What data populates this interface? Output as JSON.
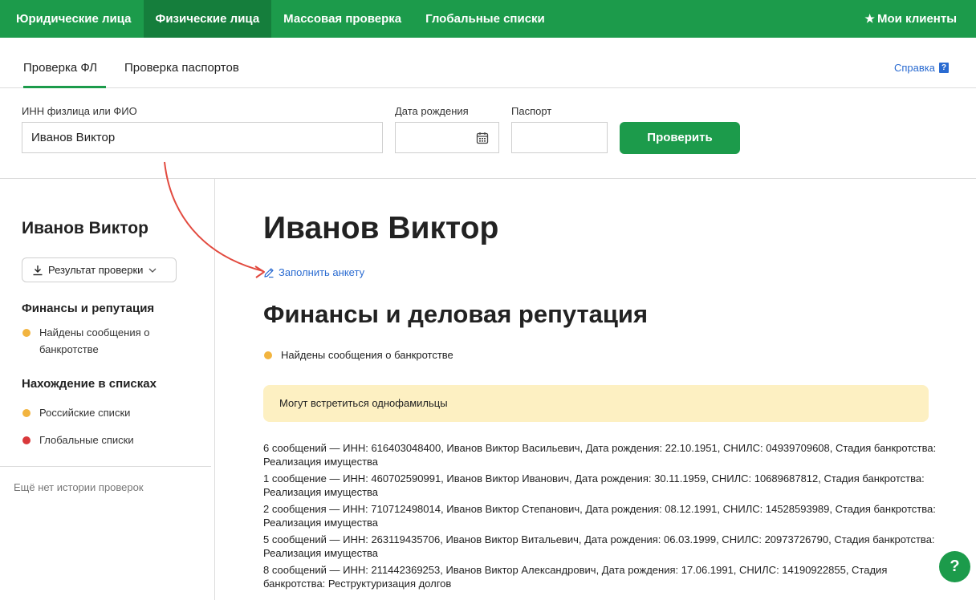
{
  "topnav": {
    "items": [
      {
        "label": "Юридические лица",
        "active": false
      },
      {
        "label": "Физические лица",
        "active": true
      },
      {
        "label": "Массовая проверка",
        "active": false
      },
      {
        "label": "Глобальные списки",
        "active": false
      }
    ],
    "my_clients_label": "Мои клиенты"
  },
  "subtabs": {
    "items": [
      {
        "label": "Проверка ФЛ",
        "active": true
      },
      {
        "label": "Проверка паспортов",
        "active": false
      }
    ],
    "help_label": "Справка",
    "help_badge": "?"
  },
  "form": {
    "name_label": "ИНН физлица или ФИО",
    "name_value": "Иванов Виктор",
    "birth_label": "Дата рождения",
    "birth_value": "",
    "passport_label": "Паспорт",
    "passport_value": "",
    "submit_label": "Проверить"
  },
  "sidebar": {
    "title": "Иванов Виктор",
    "result_button": "Результат проверки",
    "sections": [
      {
        "title": "Финансы и репутация",
        "items": [
          {
            "label": "Найдены сообщения о банкротстве",
            "status_color": "#f2b43f"
          }
        ]
      },
      {
        "title": "Нахождение в списках",
        "items": [
          {
            "label": "Российские списки",
            "status_color": "#f2b43f"
          },
          {
            "label": "Глобальные списки",
            "status_color": "#d9383a"
          }
        ]
      }
    ],
    "history_empty": "Ещё нет истории проверок"
  },
  "main": {
    "title": "Иванов Виктор",
    "fill_link": "Заполнить анкету",
    "section_title": "Финансы и деловая репутация",
    "bullet": {
      "label": "Найдены сообщения о банкротстве",
      "status_color": "#f2b43f"
    },
    "notice": "Могут встретиться однофамильцы",
    "results": [
      "6 сообщений — ИНН: 616403048400, Иванов Виктор Васильевич, Дата рождения: 22.10.1951, СНИЛС: 04939709608, Стадия банкротства: Реализация имущества",
      "1 сообщение — ИНН: 460702590991, Иванов Виктор Иванович, Дата рождения: 30.11.1959, СНИЛС: 10689687812, Стадия банкротства: Реализация имущества",
      "2 сообщения — ИНН: 710712498014, Иванов Виктор Степанович, Дата рождения: 08.12.1991, СНИЛС: 14528593989, Стадия банкротства: Реализация имущества",
      "5 сообщений — ИНН: 263119435706, Иванов Виктор Витальевич, Дата рождения: 06.03.1999, СНИЛС: 20973726790, Стадия банкротства: Реализация имущества",
      "8 сообщений — ИНН: 211442369253, Иванов Виктор Александрович, Дата рождения: 17.06.1991, СНИЛС: 14190922855, Стадия банкротства: Реструктуризация долгов"
    ]
  },
  "help_fab": "?",
  "colors": {
    "brand": "#1c9b4b",
    "link": "#2a6bd1",
    "notice_bg": "#fdf0c2",
    "annotation_arrow": "#e24a3f"
  }
}
